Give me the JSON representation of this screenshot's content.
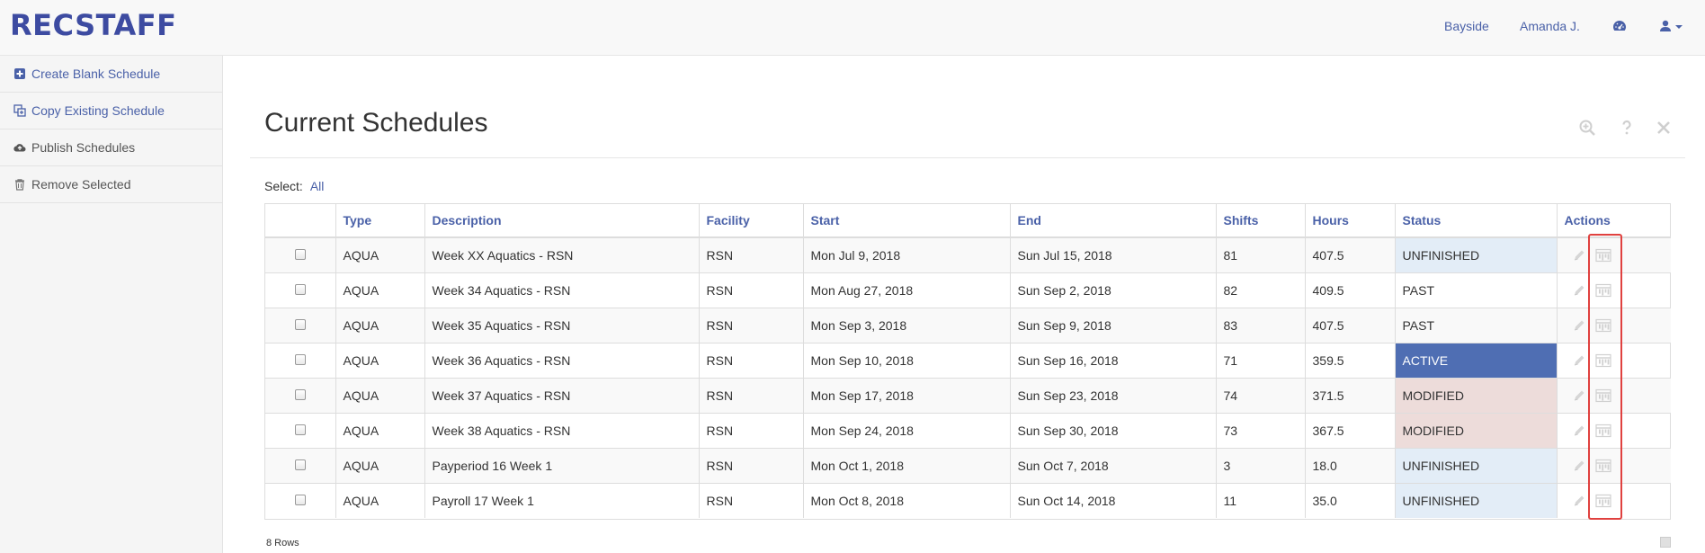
{
  "app": {
    "brand": "RECSTAFF"
  },
  "navbar": {
    "org": "Bayside",
    "user": "Amanda J.",
    "dashboard_icon": "dashboard-icon",
    "profile_icon": "user-icon"
  },
  "sidebar": {
    "items": [
      {
        "label": "Create Blank Schedule",
        "icon": "plus-square-icon",
        "style": "link"
      },
      {
        "label": "Copy Existing Schedule",
        "icon": "copy-icon",
        "style": "link"
      },
      {
        "label": "Publish Schedules",
        "icon": "cloud-upload-icon",
        "style": "plain"
      },
      {
        "label": "Remove Selected",
        "icon": "trash-icon",
        "style": "plain"
      }
    ]
  },
  "main": {
    "title": "Current Schedules",
    "select_label": "Select:",
    "select_all": "All",
    "row_count": "8 Rows"
  },
  "table": {
    "columns": [
      "",
      "Type",
      "Description",
      "Facility",
      "Start",
      "End",
      "Shifts",
      "Hours",
      "Status",
      "Actions"
    ],
    "rows": [
      {
        "type": "AQUA",
        "description": "Week XX Aquatics - RSN",
        "facility": "RSN",
        "start": "Mon Jul 9, 2018",
        "end": "Sun Jul 15, 2018",
        "shifts": "81",
        "hours": "407.5",
        "status": "UNFINISHED"
      },
      {
        "type": "AQUA",
        "description": "Week 34 Aquatics - RSN",
        "facility": "RSN",
        "start": "Mon Aug 27, 2018",
        "end": "Sun Sep 2, 2018",
        "shifts": "82",
        "hours": "409.5",
        "status": "PAST"
      },
      {
        "type": "AQUA",
        "description": "Week 35 Aquatics - RSN",
        "facility": "RSN",
        "start": "Mon Sep 3, 2018",
        "end": "Sun Sep 9, 2018",
        "shifts": "83",
        "hours": "407.5",
        "status": "PAST"
      },
      {
        "type": "AQUA",
        "description": "Week 36 Aquatics - RSN",
        "facility": "RSN",
        "start": "Mon Sep 10, 2018",
        "end": "Sun Sep 16, 2018",
        "shifts": "71",
        "hours": "359.5",
        "status": "ACTIVE"
      },
      {
        "type": "AQUA",
        "description": "Week 37 Aquatics - RSN",
        "facility": "RSN",
        "start": "Mon Sep 17, 2018",
        "end": "Sun Sep 23, 2018",
        "shifts": "74",
        "hours": "371.5",
        "status": "MODIFIED"
      },
      {
        "type": "AQUA",
        "description": "Week 38 Aquatics - RSN",
        "facility": "RSN",
        "start": "Mon Sep 24, 2018",
        "end": "Sun Sep 30, 2018",
        "shifts": "73",
        "hours": "367.5",
        "status": "MODIFIED"
      },
      {
        "type": "AQUA",
        "description": "Payperiod 16 Week 1",
        "facility": "RSN",
        "start": "Mon Oct 1, 2018",
        "end": "Sun Oct 7, 2018",
        "shifts": "3",
        "hours": "18.0",
        "status": "UNFINISHED"
      },
      {
        "type": "AQUA",
        "description": "Payroll 17 Week 1",
        "facility": "RSN",
        "start": "Mon Oct 8, 2018",
        "end": "Sun Oct 14, 2018",
        "shifts": "11",
        "hours": "35.0",
        "status": "UNFINISHED"
      }
    ]
  },
  "colors": {
    "brand": "#3d4ba1",
    "link": "#4a61a8",
    "status_unfinished": "#e3edf7",
    "status_active": "#4f6eb3",
    "status_modified": "#eddcda",
    "highlight": "#e0413f"
  }
}
